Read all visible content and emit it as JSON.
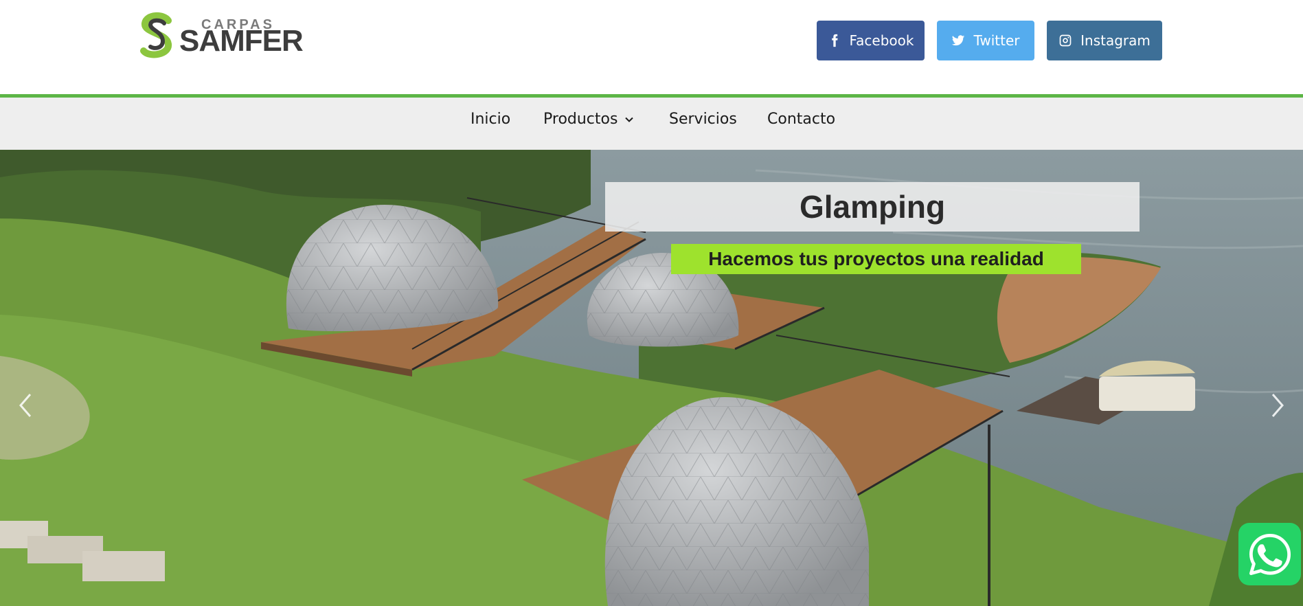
{
  "brand": {
    "small_text": "CARPAS",
    "big_text": "SAMFER",
    "colors": {
      "green": "#8cc63f",
      "grey": "#3d3d3d"
    }
  },
  "social": [
    {
      "label": "Facebook",
      "icon": "facebook-icon",
      "color": "#3b5998"
    },
    {
      "label": "Twitter",
      "icon": "twitter-icon",
      "color": "#55acee"
    },
    {
      "label": "Instagram",
      "icon": "instagram-icon",
      "color": "#3d6f97"
    }
  ],
  "nav": {
    "items": [
      {
        "label": "Inicio"
      },
      {
        "label": "Productos",
        "icon": "chevron-down-icon"
      },
      {
        "label": "Servicios"
      },
      {
        "label": "Contacto"
      }
    ]
  },
  "hero": {
    "title": "Glamping",
    "subtitle": "Hacemos tus proyectos una realidad",
    "colors": {
      "subtitle_bg": "#9ee22d",
      "accent_line": "#5cb546"
    }
  },
  "floating": {
    "whatsapp_icon": "whatsapp-icon",
    "color": "#25d366"
  }
}
